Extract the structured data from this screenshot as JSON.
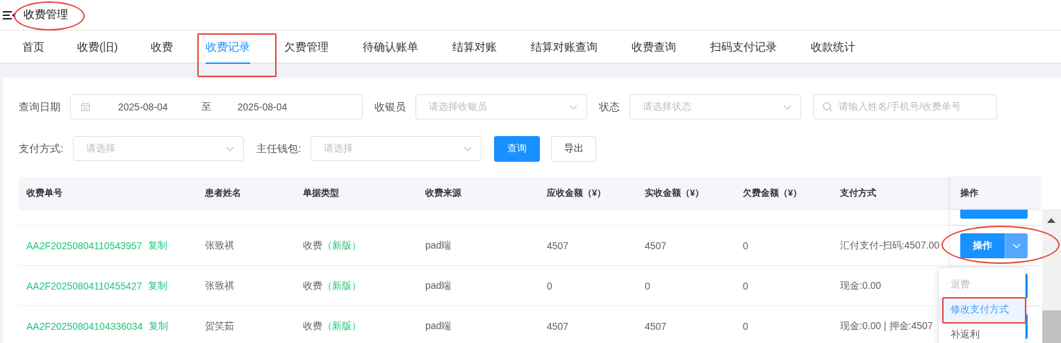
{
  "header": {
    "title": "收费管理"
  },
  "tabs": [
    {
      "label": "首页",
      "selected": false
    },
    {
      "label": "收费(旧)",
      "selected": false
    },
    {
      "label": "收费",
      "selected": false
    },
    {
      "label": "收费记录",
      "selected": true
    },
    {
      "label": "欠费管理",
      "selected": false
    },
    {
      "label": "待确认账单",
      "selected": false
    },
    {
      "label": "结算对账",
      "selected": false
    },
    {
      "label": "结算对账查询",
      "selected": false
    },
    {
      "label": "收费查询",
      "selected": false
    },
    {
      "label": "扫码支付记录",
      "selected": false
    },
    {
      "label": "收款统计",
      "selected": false
    }
  ],
  "filters": {
    "date_label": "查询日期",
    "date_start": "2025-08-04",
    "date_separator": "至",
    "date_end": "2025-08-04",
    "cashier_label": "收银员",
    "cashier_placeholder": "请选择收银员",
    "status_label": "状态",
    "status_placeholder": "请选择状态",
    "search_placeholder": "请输入姓名/手机号/收费单号",
    "payment_label": "支付方式:",
    "payment_placeholder": "请选择",
    "wallet_label": "主任钱包:",
    "wallet_placeholder": "请选择",
    "buttons": [
      {
        "label": "查询",
        "kind": "primary"
      },
      {
        "label": "导出",
        "kind": "default"
      }
    ]
  },
  "table": {
    "columns": [
      "收费单号",
      "患者姓名",
      "单据类型",
      "收费来源",
      "应收金额（¥）",
      "实收金额（¥）",
      "欠费金额（¥）",
      "支付方式",
      "操作"
    ],
    "partial_row_above": true,
    "rows": [
      {
        "order_no": "AA2F20250804110543957",
        "copy": "复制",
        "patient": "张致祺",
        "type": "收费",
        "type_tag": "（新版）",
        "source": "pad端",
        "receivable": "4507",
        "received": "4507",
        "arrears": "0",
        "payment": "汇付支付-扫码:4507.00",
        "action": {
          "kind": "full",
          "label": "操作"
        }
      },
      {
        "order_no": "AA2F20250804110455427",
        "copy": "复制",
        "patient": "张致祺",
        "type": "收费",
        "type_tag": "（新版）",
        "source": "pad端",
        "receivable": "0",
        "received": "0",
        "arrears": "0",
        "payment": "现金:0.00",
        "action": {
          "kind": "covered"
        }
      },
      {
        "order_no": "AA2F20250804104336034",
        "copy": "复制",
        "patient": "贺笑茹",
        "type": "收费",
        "type_tag": "（新版）",
        "source": "pad端",
        "receivable": "4507",
        "received": "4507",
        "arrears": "0",
        "payment": "现金:0.00 | 押金:4507",
        "action": {
          "kind": "covered"
        }
      }
    ]
  },
  "action_menu": [
    {
      "label": "退费",
      "disabled": true,
      "selected": false
    },
    {
      "label": "修改支付方式",
      "disabled": false,
      "selected": true
    },
    {
      "label": "补返利",
      "disabled": false,
      "selected": false
    }
  ],
  "annotations": [
    {
      "kind": "ellipse"
    },
    {
      "kind": "rect"
    },
    {
      "kind": "ellipse"
    },
    {
      "kind": "rect"
    }
  ]
}
